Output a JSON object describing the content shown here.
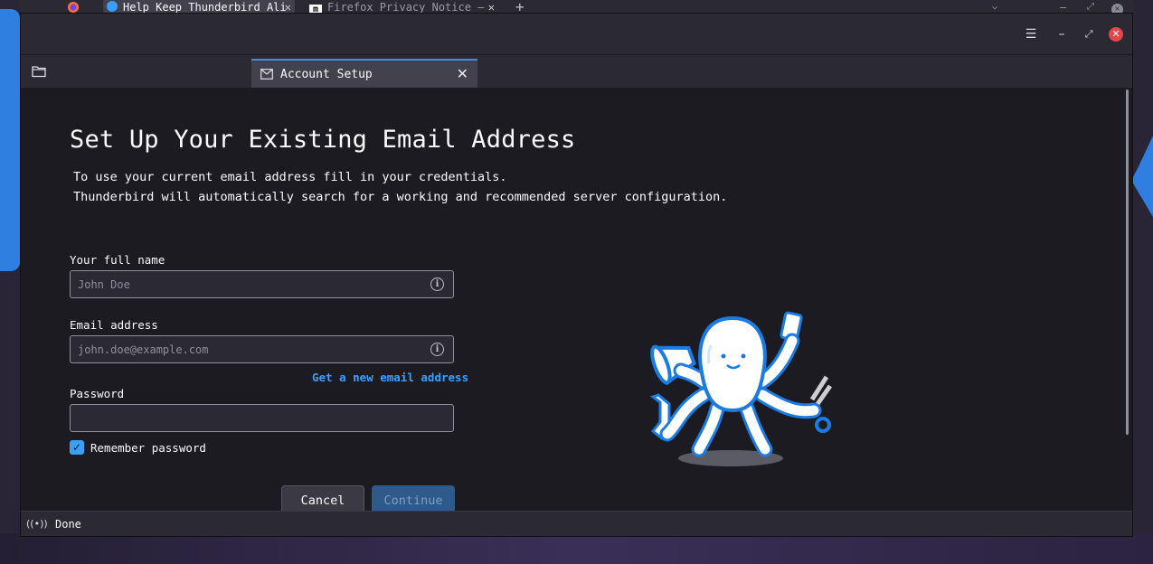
{
  "browser": {
    "tabs": [
      {
        "label": "Help Keep Thunderbird Ali",
        "close": "✕"
      },
      {
        "label": "Firefox Privacy Notice —",
        "close": "✕"
      }
    ],
    "new_tab": "+"
  },
  "window": {
    "controls": {
      "menu": "☰",
      "minimize": "–",
      "maximize": "⤢",
      "close": "✕"
    }
  },
  "tab": {
    "label": "Account Setup",
    "close": "✕",
    "icon": "mail-setup-icon"
  },
  "page": {
    "title": "Set Up Your Existing Email Address",
    "intro_line1": "To use your current email address fill in your credentials.",
    "intro_line2": "Thunderbird will automatically search for a working and recommended server configuration."
  },
  "form": {
    "name_label": "Your full name",
    "name_placeholder": "John Doe",
    "name_value": "",
    "email_label": "Email address",
    "email_placeholder": "john.doe@example.com",
    "email_value": "",
    "new_email_link": "Get a new email address",
    "password_label": "Password",
    "password_value": "",
    "remember_label": "Remember password",
    "remember_checked": true,
    "cancel_label": "Cancel",
    "continue_label": "Continue"
  },
  "status": {
    "text": "Done",
    "icon": "activity-icon"
  },
  "colors": {
    "accent": "#3aa0ff",
    "continue_disabled": "#2d5a8b",
    "close_red": "#e0474a"
  }
}
